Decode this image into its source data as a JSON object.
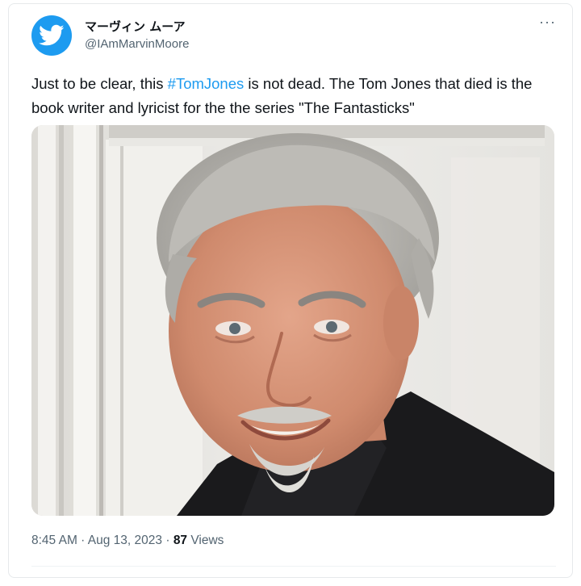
{
  "author": {
    "display_name": "マーヴィン ムーア",
    "handle": "@IAmMarvinMoore",
    "avatar_icon": "twitter-bird-icon"
  },
  "more_icon": "ellipsis-icon",
  "tweet": {
    "text_before": "Just to be clear, this ",
    "hashtag": "#TomJones",
    "text_after": " is not dead.  The Tom Jones that died is the book writer and lyricist for the the series \"The Fantasticks\""
  },
  "meta": {
    "time": "8:45 AM",
    "sep1": " · ",
    "date": "Aug 13, 2023",
    "sep2": " · ",
    "views_count": "87",
    "views_label": " Views"
  },
  "colors": {
    "accent": "#1d9bf0",
    "text": "#0f1419",
    "secondary": "#536471"
  }
}
